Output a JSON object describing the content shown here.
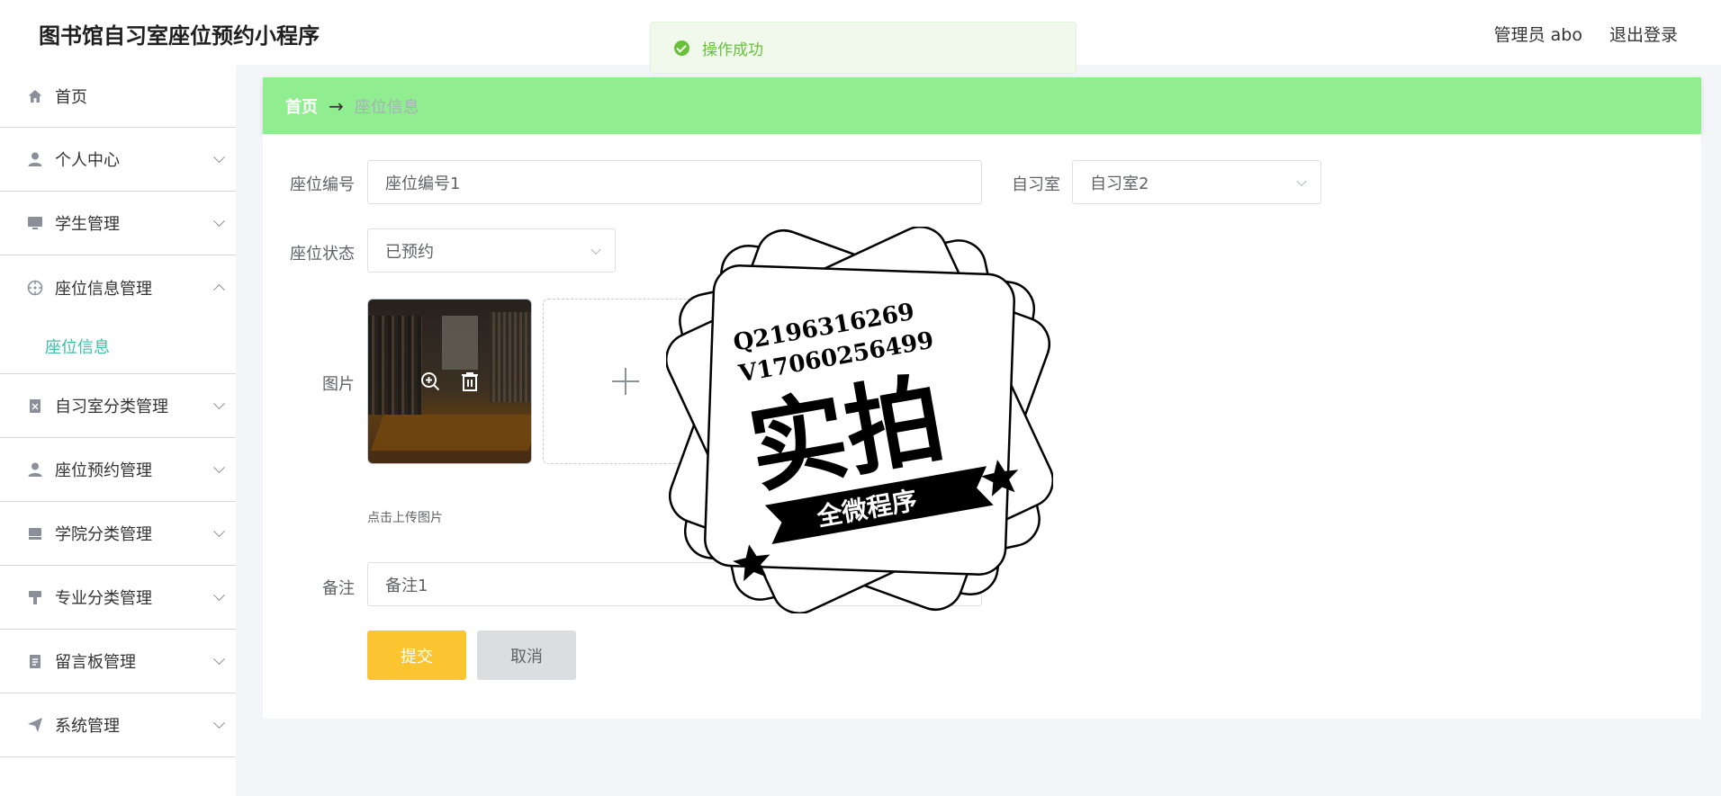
{
  "app": {
    "title": "图书馆自习室座位预约小程序",
    "admin_label": "管理员 abo",
    "logout_label": "退出登录"
  },
  "toast": {
    "message": "操作成功"
  },
  "sidebar": {
    "items": [
      {
        "label": "首页",
        "icon": "home-icon"
      },
      {
        "label": "个人中心",
        "icon": "user-icon"
      },
      {
        "label": "学生管理",
        "icon": "monitor-icon"
      },
      {
        "label": "座位信息管理",
        "icon": "compass-icon",
        "expanded": true
      },
      {
        "label": "自习室分类管理",
        "icon": "clipboard-icon"
      },
      {
        "label": "座位预约管理",
        "icon": "user-icon"
      },
      {
        "label": "学院分类管理",
        "icon": "box-icon"
      },
      {
        "label": "专业分类管理",
        "icon": "brush-icon"
      },
      {
        "label": "留言板管理",
        "icon": "document-icon"
      },
      {
        "label": "系统管理",
        "icon": "send-icon"
      }
    ],
    "submenu": {
      "label": "座位信息"
    }
  },
  "breadcrumb": {
    "home": "首页",
    "separator": "→",
    "current": "座位信息"
  },
  "form": {
    "seat_no": {
      "label": "座位编号",
      "value": "座位编号1"
    },
    "study_room": {
      "label": "自习室",
      "value": "自习室2"
    },
    "status": {
      "label": "座位状态",
      "value": "已预约"
    },
    "image": {
      "label": "图片",
      "hint": "点击上传图片"
    },
    "remark": {
      "label": "备注",
      "value": "备注1"
    },
    "submit_label": "提交",
    "cancel_label": "取消"
  },
  "watermark": {
    "line1": "Q2196316269",
    "line2": "V17060256499",
    "big": "实拍",
    "ribbon": "全微程序"
  },
  "colors": {
    "breadcrumb_bg": "#90ee90",
    "submenu_active": "#3dbfa9",
    "submit_bg": "#fbc531",
    "cancel_bg": "#dcdde1",
    "toast_green": "#67c23a"
  }
}
